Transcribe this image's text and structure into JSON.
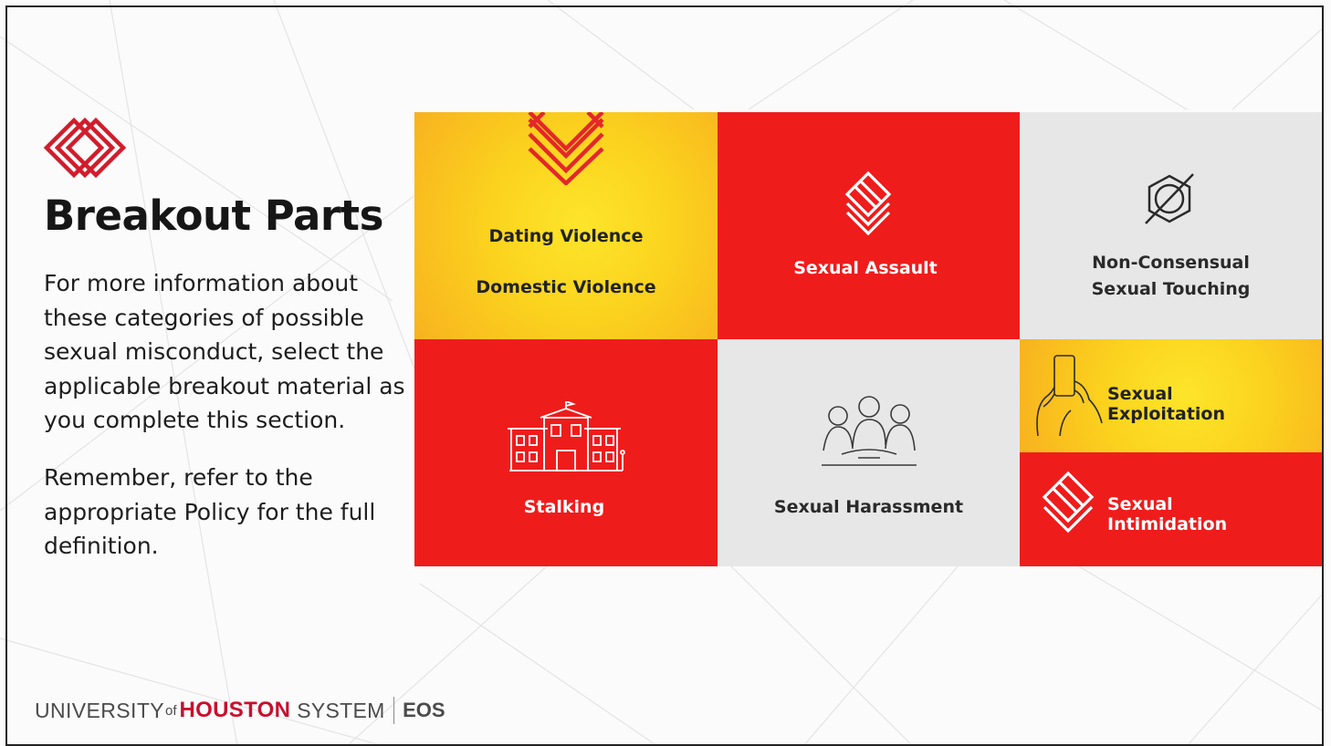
{
  "slide": {
    "title": "Breakout Parts",
    "paragraph_1": "For more information about these categories of possible sexual misconduct, select the applicable breakout material as you complete this section.",
    "paragraph_2": "Remember, refer to the appropriate Policy for the full definition."
  },
  "tiles": {
    "dating": {
      "line_1": "Dating Violence",
      "line_2": "Domestic Violence",
      "icon": "diamond-stack-icon"
    },
    "assault": {
      "label": "Sexual Assault",
      "icon": "diamond-stack-icon"
    },
    "touching": {
      "line_1": "Non-Consensual",
      "line_2": "Sexual Touching",
      "icon": "crossed-out-circle-icon"
    },
    "stalking": {
      "label": "Stalking",
      "icon": "building-icon"
    },
    "harassment": {
      "label": "Sexual Harassment",
      "icon": "group-of-people-icon"
    },
    "exploitation": {
      "label": "Sexual Exploitation",
      "icon": "hands-holding-phone-icon"
    },
    "intimidation": {
      "label": "Sexual Intimidation",
      "icon": "diamond-stack-icon"
    }
  },
  "footer": {
    "university": "UNIVERSITY",
    "of": "of",
    "houston": "HOUSTON",
    "system": "SYSTEM",
    "office": "EOS"
  },
  "colors": {
    "red": "#ef1c1c",
    "gold": "#fbd31e",
    "grey": "#e7e7e7",
    "brand_red": "#c8102e"
  }
}
